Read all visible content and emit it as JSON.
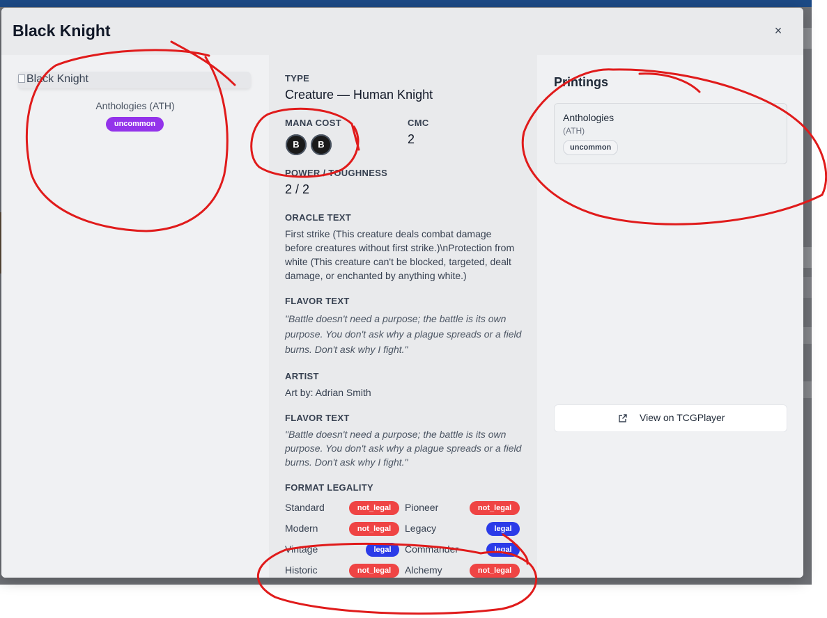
{
  "modal": {
    "title": "Black Knight",
    "close_symbol": "×"
  },
  "card": {
    "image_alt": "Black Knight",
    "set_caption": "Anthologies (ATH)",
    "rarity": "uncommon",
    "rarity_color": "#9333ea"
  },
  "details": {
    "type_label": "TYPE",
    "type_value": "Creature — Human Knight",
    "mana_cost_label": "MANA COST",
    "mana_symbols": [
      "B",
      "B"
    ],
    "cmc_label": "CMC",
    "cmc_value": "2",
    "pt_label": "POWER / TOUGHNESS",
    "pt_value": "2 / 2",
    "oracle_label": "ORACLE TEXT",
    "oracle_text": "First strike (This creature deals combat damage before creatures without first strike.)\\nProtection from white (This creature can't be blocked, targeted, dealt damage, or enchanted by anything white.)",
    "flavor_label_1": "FLAVOR TEXT",
    "flavor_text_1": "\"Battle doesn't need a purpose; the battle is its own purpose. You don't ask why a plague spreads or a field burns. Don't ask why I fight.\"",
    "artist_label": "ARTIST",
    "artist_value": "Art by: Adrian Smith",
    "flavor_label_2": "FLAVOR TEXT",
    "flavor_text_2": "\"Battle doesn't need a purpose; the battle is its own purpose. You don't ask why a plague spreads or a field burns. Don't ask why I fight.\"",
    "legality_label": "FORMAT LEGALITY",
    "legality": [
      {
        "format": "Standard",
        "status": "not_legal"
      },
      {
        "format": "Pioneer",
        "status": "not_legal"
      },
      {
        "format": "Modern",
        "status": "not_legal"
      },
      {
        "format": "Legacy",
        "status": "legal"
      },
      {
        "format": "Vintage",
        "status": "legal"
      },
      {
        "format": "Commander",
        "status": "legal"
      },
      {
        "format": "Historic",
        "status": "not_legal"
      },
      {
        "format": "Alchemy",
        "status": "not_legal"
      }
    ]
  },
  "printings": {
    "title": "Printings",
    "items": [
      {
        "set_name": "Anthologies",
        "set_code": "(ATH)",
        "rarity": "uncommon"
      }
    ],
    "tcg_button_label": "View on TCGPlayer",
    "tcg_icon": "external-link-icon"
  },
  "colors": {
    "not_legal": "#ef4444",
    "legal": "#2b3be8",
    "annotation": "#e01b1b",
    "header_bar": "#1c4a86"
  }
}
